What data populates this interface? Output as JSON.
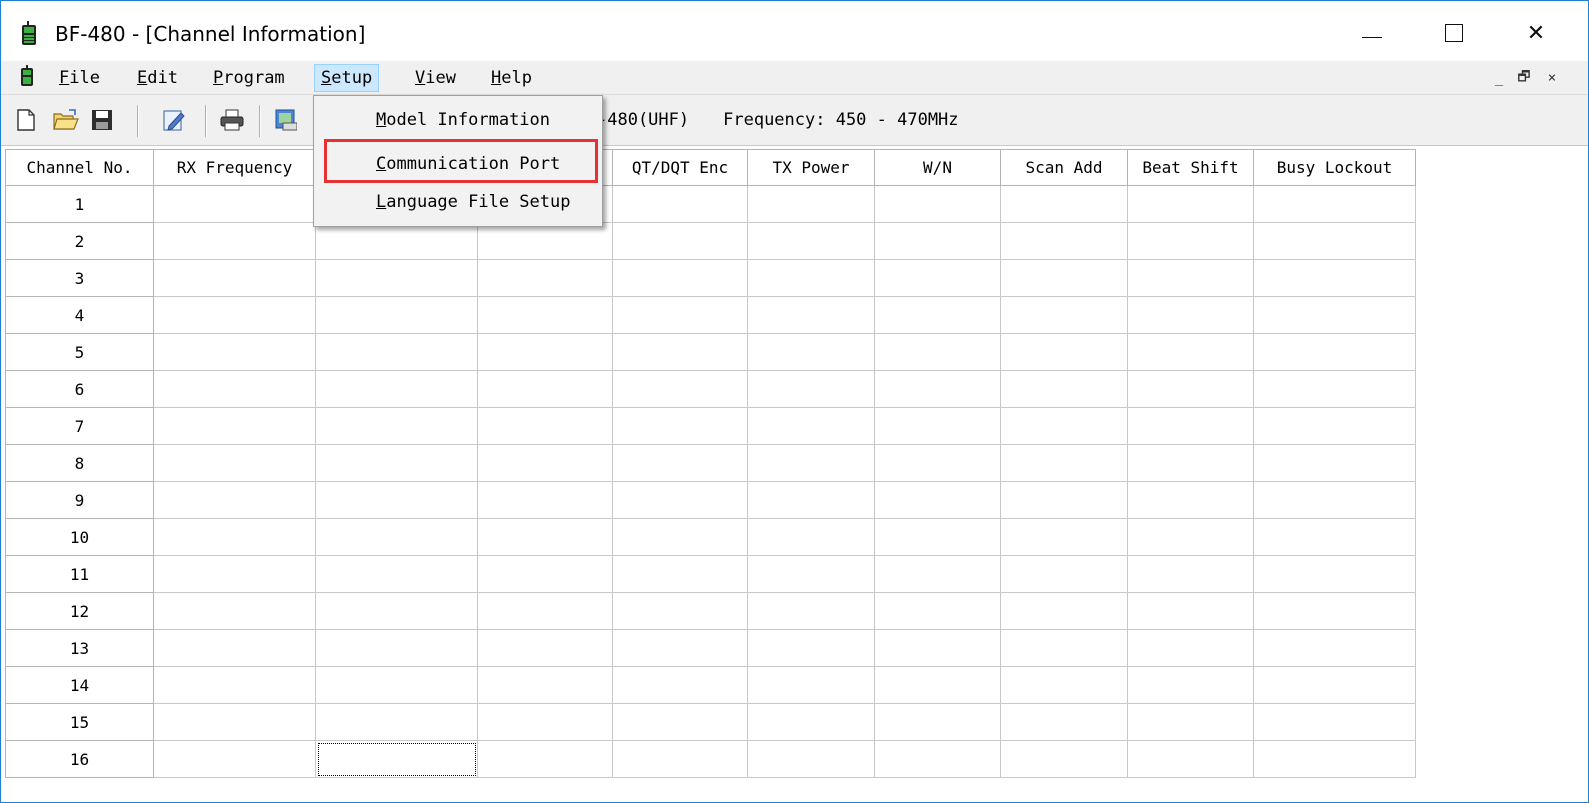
{
  "window": {
    "title": "BF-480 - [Channel Information]",
    "controls": {
      "minimize": "—",
      "maximize": "☐",
      "close": "✕"
    }
  },
  "menubar": {
    "items": [
      {
        "label": "File",
        "mnemonic": "F",
        "rest": "ile"
      },
      {
        "label": "Edit",
        "mnemonic": "E",
        "rest": "dit"
      },
      {
        "label": "Program",
        "mnemonic": "P",
        "rest": "rogram"
      },
      {
        "label": "Setup",
        "mnemonic": "S",
        "rest": "etup",
        "active": true
      },
      {
        "label": "View",
        "mnemonic": "V",
        "rest": "iew"
      },
      {
        "label": "Help",
        "mnemonic": "H",
        "rest": "elp"
      }
    ],
    "mdi_controls": [
      "_",
      "🗗",
      "×"
    ]
  },
  "toolbar": {
    "buttons": [
      "new-file-icon",
      "open-folder-icon",
      "save-disk-icon",
      "edit-icon",
      "print-icon",
      "program-icon"
    ],
    "model_text": "-480(UHF)",
    "frequency_text": "Frequency: 450 - 470MHz"
  },
  "setup_menu": {
    "items": [
      {
        "label": "Model Information",
        "mnemonic": "M",
        "rest": "odel Information"
      },
      {
        "label": "Communication Port",
        "mnemonic": "C",
        "rest": "ommunication Port",
        "highlighted": true
      },
      {
        "label": "Language File Setup",
        "mnemonic": "L",
        "rest": "anguage File Setup"
      }
    ],
    "highlight_color": "#e53333"
  },
  "grid": {
    "columns": [
      "Channel No.",
      "RX Frequency",
      "",
      "",
      "QT/DQT Enc",
      "TX Power",
      "W/N",
      "Scan Add",
      "Beat Shift",
      "Busy Lockout"
    ],
    "rows": [
      "1",
      "2",
      "3",
      "4",
      "5",
      "6",
      "7",
      "8",
      "9",
      "10",
      "11",
      "12",
      "13",
      "14",
      "15",
      "16"
    ],
    "focused_cell": {
      "row": "16",
      "column_index": 2
    }
  },
  "colors": {
    "menu_active_bg": "#cce8ff",
    "window_border": "#1e7fd8",
    "app_icon": "#2d8a2d"
  }
}
